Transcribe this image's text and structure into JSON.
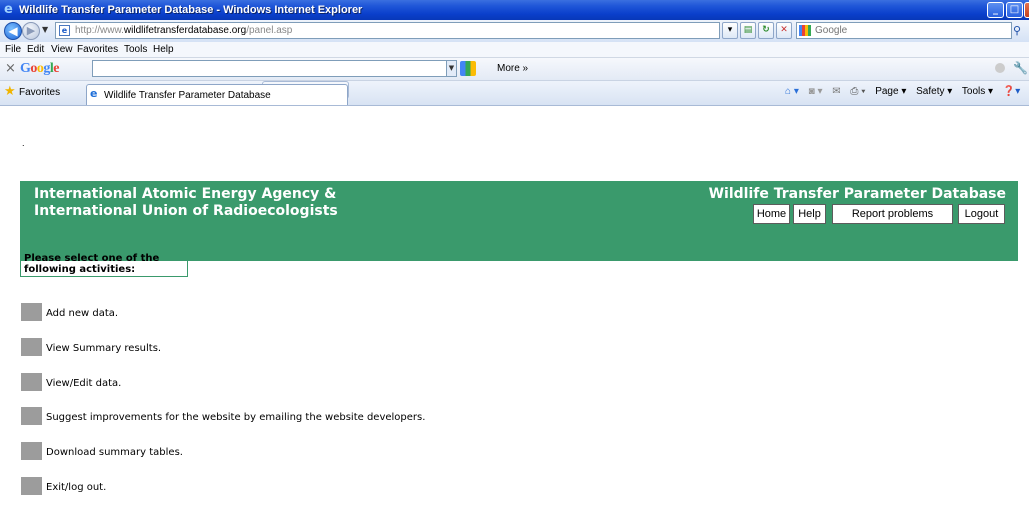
{
  "window": {
    "title": "Wildlife Transfer Parameter Database - Windows Internet Explorer",
    "min_glyph": "_",
    "max_glyph": "□",
    "close_glyph": "✕"
  },
  "address_bar": {
    "url_prefix": "http://www.",
    "url_domain": "wildlifetransferdatabase.org",
    "url_path": "/panel.asp",
    "search_placeholder": "Google"
  },
  "menu": [
    "File",
    "Edit",
    "View",
    "Favorites",
    "Tools",
    "Help"
  ],
  "google_toolbar": {
    "logo": "Google",
    "more_label": "More »"
  },
  "favorites_bar": {
    "favorites_label": "Favorites",
    "tab_title": "Wildlife Transfer Parameter Database",
    "commands": [
      "Page ▾",
      "Safety ▾",
      "Tools ▾"
    ]
  },
  "page": {
    "dot": ".",
    "header": {
      "org_line1": "International Atomic Energy Agency &",
      "org_line2": "International Union of Radioecologists",
      "db_title": "Wildlife Transfer Parameter Database"
    },
    "nav": {
      "home": "Home",
      "help": "Help",
      "report": "Report problems",
      "logout": "Logout"
    },
    "prompt": "Please select one of the following activities:",
    "activities": [
      "Add new data.",
      "View Summary results.",
      "View/Edit data.",
      "Suggest improvements for the website by emailing the website developers.",
      "Download summary tables.",
      "Exit/log out."
    ]
  },
  "colors": {
    "banner": "#3a9a6c",
    "titlebar": "#0a3fcb",
    "activity_button": "#9c9c9c"
  }
}
